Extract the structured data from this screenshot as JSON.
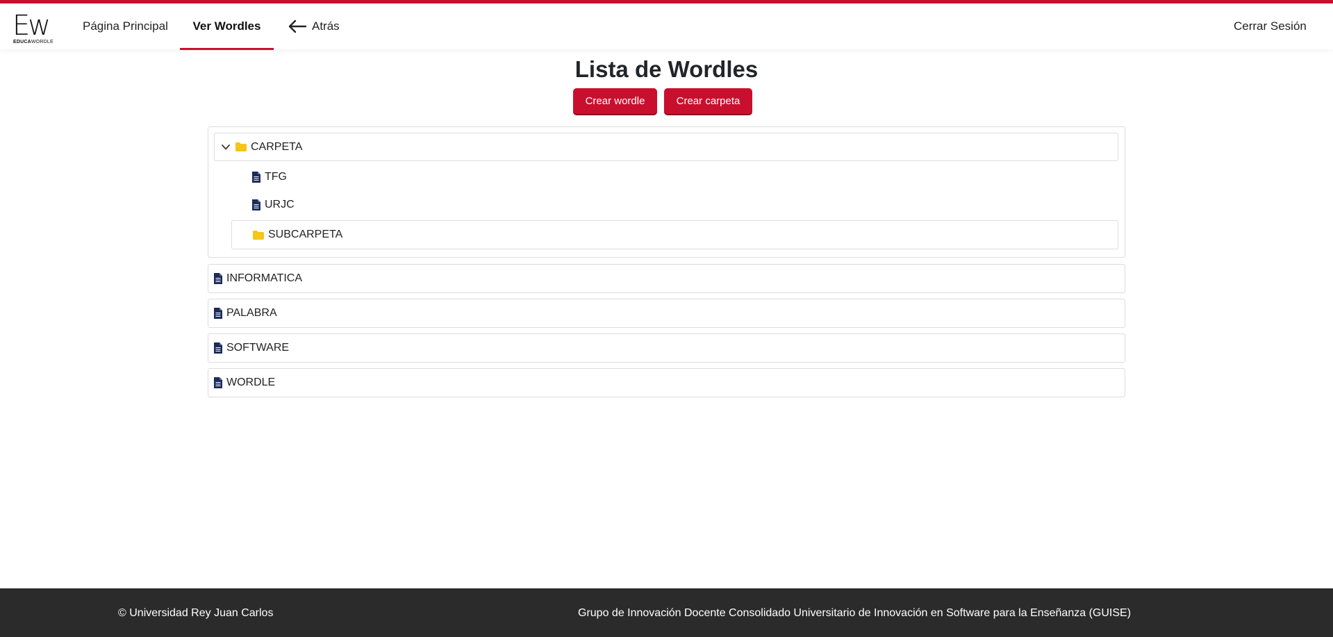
{
  "app": {
    "logo_mark": "Ew",
    "logo_sub_bold": "EDUCA",
    "logo_sub": "WORDLE"
  },
  "nav": {
    "home": "Página Principal",
    "wordles": "Ver Wordles",
    "back": "Atrás",
    "logout": "Cerrar Sesión"
  },
  "main": {
    "title": "Lista de Wordles",
    "create_wordle": "Crear wordle",
    "create_folder": "Crear carpeta"
  },
  "tree": {
    "folder": {
      "name": "CARPETA",
      "expanded": true,
      "items": [
        "TFG",
        "URJC"
      ],
      "subfolder": "SUBCARPETA"
    },
    "items": [
      "INFORMATICA",
      "PALABRA",
      "SOFTWARE",
      "WORDLE"
    ]
  },
  "footer": {
    "left": "© Universidad Rey Juan Carlos",
    "right": "Grupo de Innovación Docente Consolidado Universitario de Innovación en Software para la Enseñanza (GUISE)"
  },
  "colors": {
    "accent": "#c8102e",
    "folder": "#f5c518",
    "file": "#1c2b5a",
    "footer": "#2b2b2b"
  }
}
